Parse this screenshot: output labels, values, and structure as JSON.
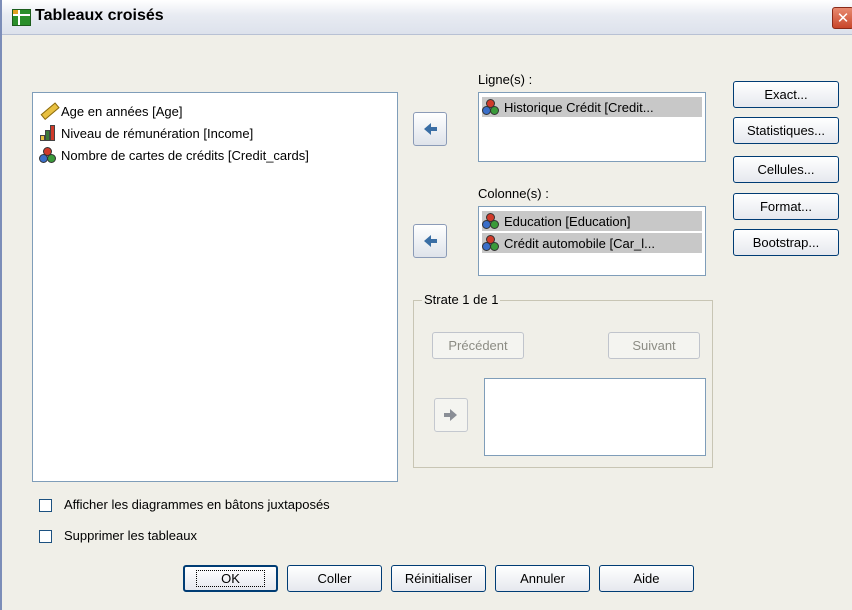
{
  "window": {
    "title": "Tableaux croisés",
    "close_label": "✕"
  },
  "source_list": {
    "items": [
      {
        "label": "Age en années [Age]",
        "icon": "ruler-icon"
      },
      {
        "label": "Niveau de rémunération [Income]",
        "icon": "ordinal-bars-icon"
      },
      {
        "label": "Nombre de cartes de crédits [Credit_cards]",
        "icon": "nominal-balls-icon"
      }
    ]
  },
  "rows": {
    "label": "Ligne(s) :",
    "items": [
      {
        "label": "Historique Crédit [Credit...",
        "icon": "nominal-balls-icon"
      }
    ]
  },
  "columns": {
    "label": "Colonne(s) :",
    "items": [
      {
        "label": "Education [Education]",
        "icon": "nominal-balls-icon"
      },
      {
        "label": "Crédit automobile [Car_l...",
        "icon": "nominal-balls-icon"
      }
    ]
  },
  "layer": {
    "title": "Strate 1 de 1",
    "previous_label": "Précédent",
    "next_label": "Suivant"
  },
  "side_buttons": {
    "exact": "Exact...",
    "statistics": "Statistiques...",
    "cells": "Cellules...",
    "format": "Format...",
    "bootstrap": "Bootstrap..."
  },
  "options": {
    "clustered_bars": {
      "label": "Afficher les diagrammes en bâtons juxtaposés",
      "checked": false
    },
    "suppress_tables": {
      "label": "Supprimer les tableaux",
      "checked": false
    }
  },
  "bottom_buttons": {
    "ok": "OK",
    "paste": "Coller",
    "reset": "Réinitialiser",
    "cancel": "Annuler",
    "help": "Aide"
  },
  "colors": {
    "accent": "#3a6ea5",
    "selection": "#c8c8c8",
    "window_bg": "#f0efe8"
  }
}
